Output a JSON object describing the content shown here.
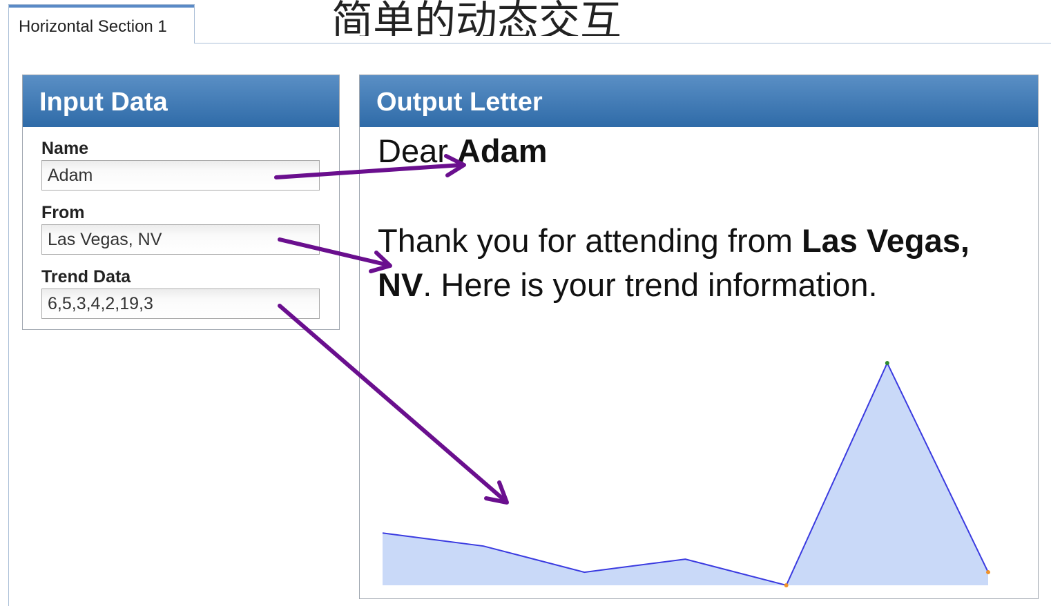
{
  "slide": {
    "title": "简单的动态交互"
  },
  "tabs": [
    {
      "label": "Horizontal Section 1"
    }
  ],
  "input_panel": {
    "title": "Input Data",
    "fields": [
      {
        "label": "Name",
        "value": "Adam"
      },
      {
        "label": "From",
        "value": "Las Vegas, NV"
      },
      {
        "label": "Trend Data",
        "value": "6,5,3,4,2,19,3"
      }
    ]
  },
  "output_panel": {
    "title": "Output Letter",
    "greeting_prefix": "Dear ",
    "name": "Adam",
    "thank_prefix": "Thank you for attending from ",
    "from": "Las Vegas, NV",
    "thank_suffix": ". Here is your trend information."
  },
  "chart_data": {
    "type": "area",
    "values": [
      6,
      5,
      3,
      4,
      2,
      19,
      3
    ],
    "line_color": "#3a3ae0",
    "fill_color": "#c9d9f8",
    "min_marker_color": "#f0922a",
    "max_marker_color": "#2e8b2e"
  },
  "annotations": {
    "arrow_color": "#6a0f8e"
  }
}
